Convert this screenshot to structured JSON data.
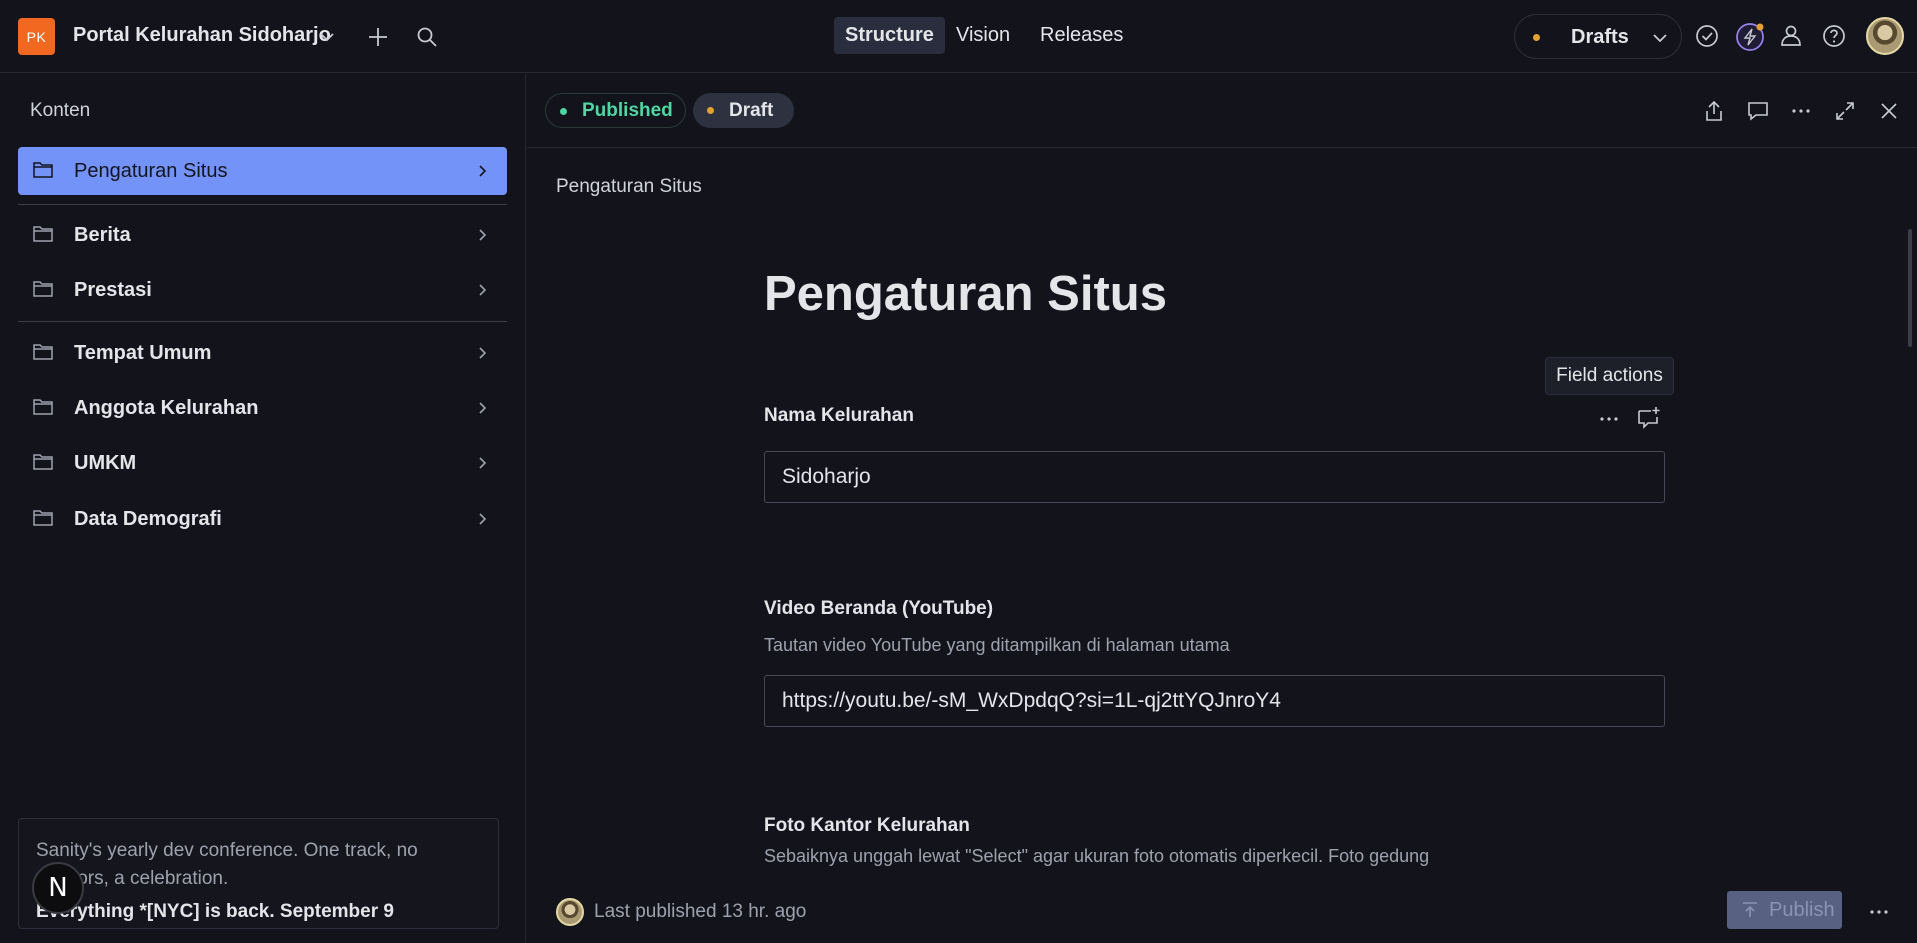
{
  "topbar": {
    "logo_initials": "PK",
    "project_name": "Portal Kelurahan Sidoharjo",
    "tabs": [
      {
        "label": "Structure",
        "active": true
      },
      {
        "label": "Vision",
        "active": false
      },
      {
        "label": "Releases",
        "active": false
      }
    ],
    "perspective_label": "Drafts",
    "icons": [
      "plus-icon",
      "search-icon",
      "check-circle-icon",
      "bolt-icon",
      "people-icon",
      "help-icon",
      "avatar"
    ]
  },
  "sidebar": {
    "title": "Konten",
    "items": [
      {
        "label": "Pengaturan Situs",
        "selected": true
      },
      {
        "label": "Berita",
        "selected": false
      },
      {
        "label": "Prestasi",
        "selected": false
      },
      {
        "label": "Tempat Umum",
        "selected": false
      },
      {
        "label": "Anggota Kelurahan",
        "selected": false
      },
      {
        "label": "UMKM",
        "selected": false
      },
      {
        "label": "Data Demografi",
        "selected": false
      }
    ],
    "promo": {
      "text": "Sanity's yearly dev conference. One track, no vendors, a celebration.",
      "bold": "Everything *[NYC] is back. September 9"
    },
    "n_badge": "N"
  },
  "document": {
    "chips": {
      "published": "Published",
      "draft": "Draft"
    },
    "breadcrumb": "Pengaturan Situs",
    "title": "Pengaturan Situs",
    "tooltip": "Field actions",
    "fields": {
      "nama_kelurahan": {
        "label": "Nama Kelurahan",
        "value": "Sidoharjo"
      },
      "video_beranda": {
        "label": "Video Beranda (YouTube)",
        "description": "Tautan video YouTube yang ditampilkan di halaman utama",
        "value": "https://youtu.be/-sM_WxDpdqQ?si=1L-qj2ttYQJnroY4"
      },
      "foto_kantor": {
        "label": "Foto Kantor Kelurahan",
        "description": "Sebaiknya unggah lewat \"Select\" agar ukuran foto otomatis diperkecil. Foto gedung"
      }
    },
    "footer": {
      "status": "Last published 13 hr. ago",
      "publish_label": "Publish"
    }
  },
  "colors": {
    "background": "#13141b",
    "accent_selected": "#7493f8",
    "published_green": "#4fd6a2",
    "draft_orange": "#e5a234",
    "logo_orange": "#f36821"
  }
}
